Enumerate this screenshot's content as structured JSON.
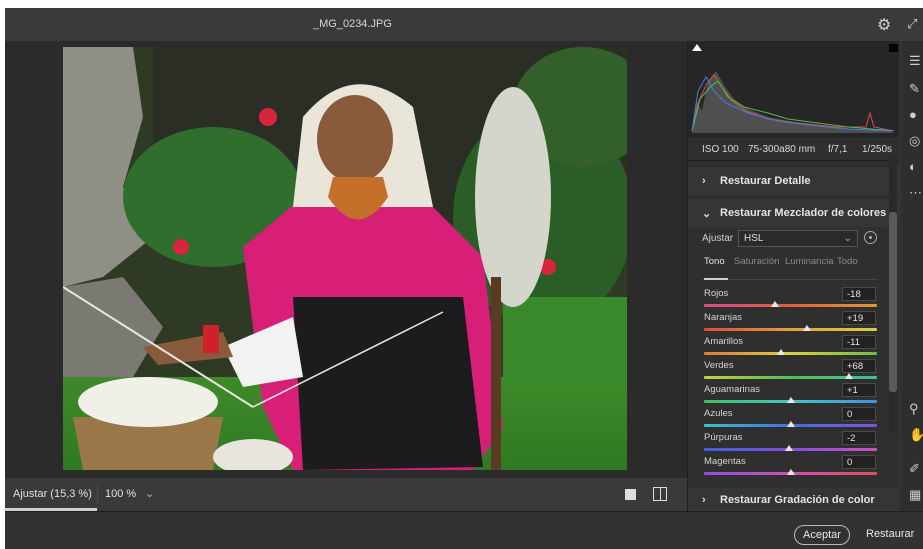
{
  "window": {
    "title": "_MG_0234.JPG"
  },
  "status": {
    "zoom_label": "Ajustar (15,3 %)",
    "zoom_value": "100 %"
  },
  "camera": {
    "iso": "ISO 100",
    "lens": "75-300a80 mm",
    "aperture": "f/7,1",
    "shutter": "1/250s"
  },
  "sections": {
    "detail": "Restaurar Detalle",
    "mixer": "Restaurar Mezclador de colores",
    "grading": "Restaurar Gradación de color"
  },
  "mixer": {
    "adjust_label": "Ajustar",
    "adjust_value": "HSL",
    "tabs": [
      "Tono",
      "Saturación",
      "Luminancia",
      "Todo"
    ],
    "active_tab": "Tono",
    "sliders": [
      {
        "name": "Rojos",
        "value": "-18",
        "level": -18,
        "gradient": [
          "#d94a8c",
          "#e0603a",
          "#e0993a"
        ]
      },
      {
        "name": "Naranjas",
        "value": "+19",
        "level": 19,
        "gradient": [
          "#e04a3a",
          "#e0a03a",
          "#d8d040"
        ]
      },
      {
        "name": "Amarillos",
        "value": "-11",
        "level": -11,
        "gradient": [
          "#e07a3a",
          "#d8d040",
          "#70c040"
        ]
      },
      {
        "name": "Verdes",
        "value": "+68",
        "level": 68,
        "gradient": [
          "#c8d040",
          "#50c050",
          "#40c0a0"
        ]
      },
      {
        "name": "Aguamarinas",
        "value": "+1",
        "level": 1,
        "gradient": [
          "#40c060",
          "#40c8c0",
          "#4090e0"
        ]
      },
      {
        "name": "Azules",
        "value": "0",
        "level": 0,
        "gradient": [
          "#40c0c8",
          "#4070e0",
          "#8050e0"
        ]
      },
      {
        "name": "Púrpuras",
        "value": "-2",
        "level": -2,
        "gradient": [
          "#4060e0",
          "#8050e0",
          "#d050c0"
        ]
      },
      {
        "name": "Magentas",
        "value": "0",
        "level": 0,
        "gradient": [
          "#8a50e0",
          "#d050b0",
          "#e05060"
        ]
      }
    ]
  },
  "footer": {
    "ok_label": "Aceptar",
    "reset_label": "Restaurar"
  },
  "icons": {
    "settings": "gear-icon",
    "expand": "expand-icon",
    "view_single": "single-view-icon",
    "view_compare": "compare-view-icon"
  }
}
